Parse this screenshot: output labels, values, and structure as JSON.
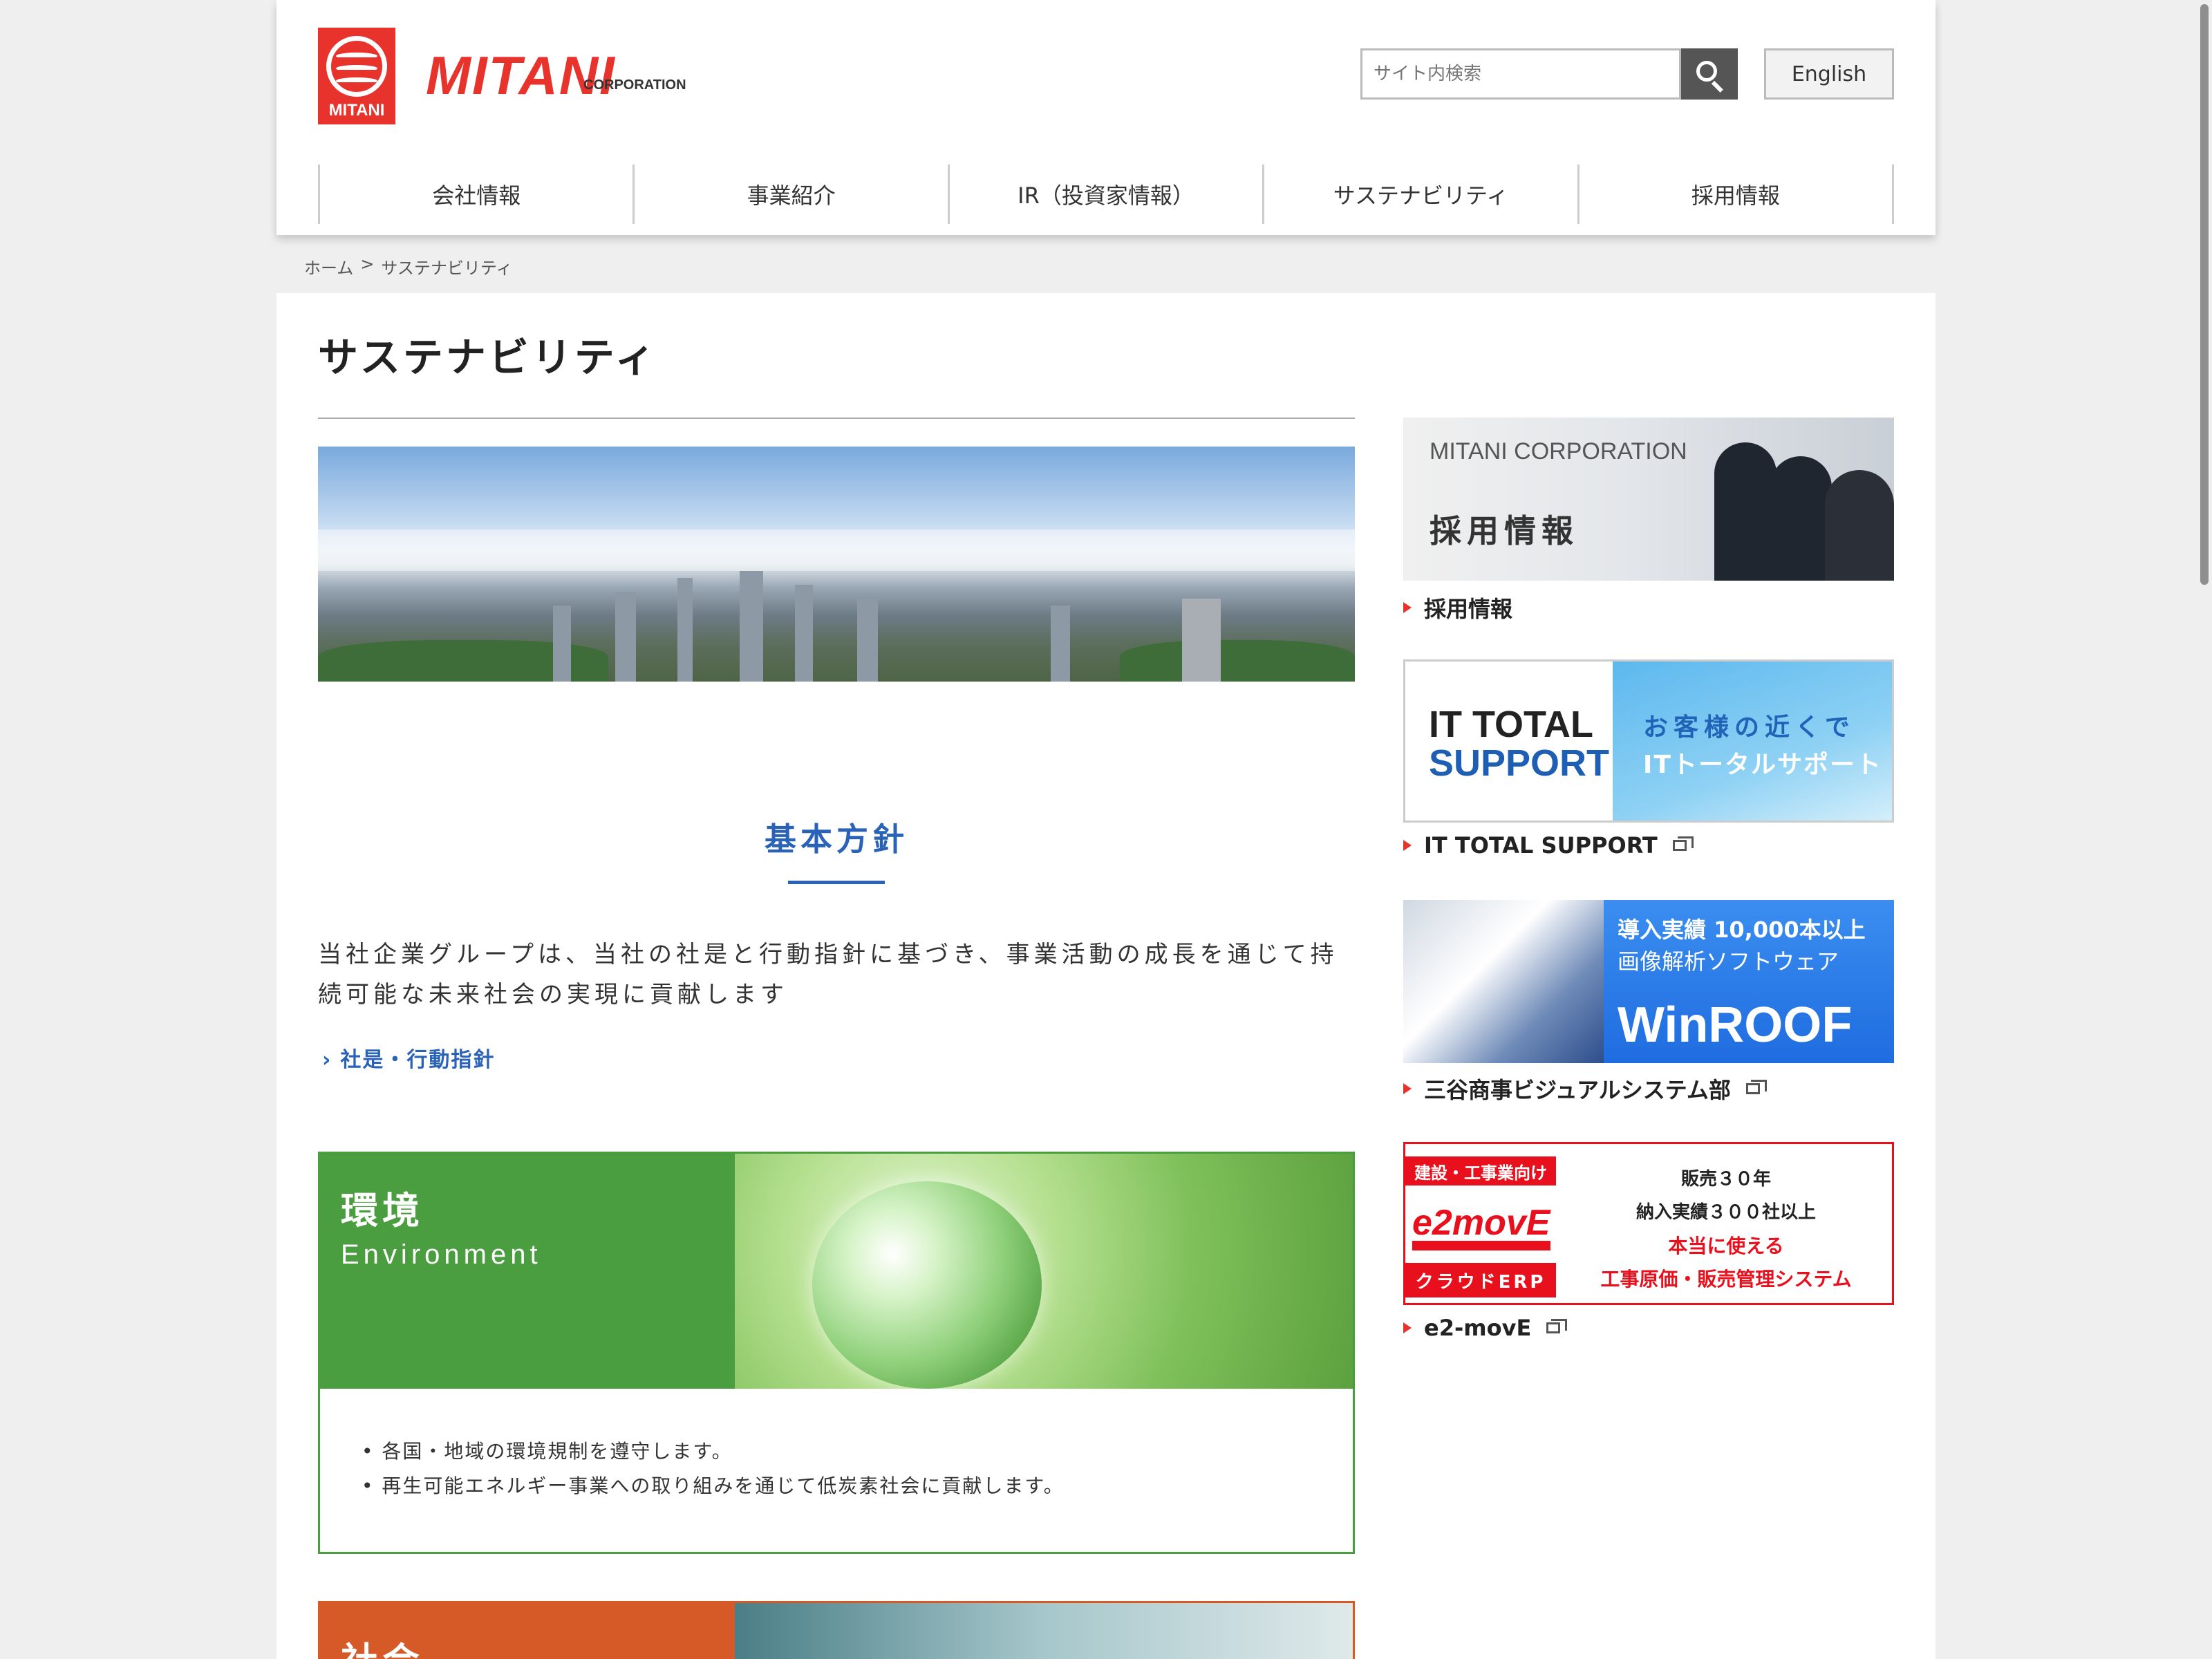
{
  "brand": {
    "logo_mark_text": "MITANI",
    "name": "MITANI",
    "sub": "CORPORATION",
    "color": "#e8322c"
  },
  "header": {
    "search_placeholder": "サイト内検索",
    "search_icon": "search-icon",
    "language_label": "English"
  },
  "nav": {
    "items": [
      "会社情報",
      "事業紹介",
      "IR（投資家情報）",
      "サステナビリティ",
      "採用情報"
    ]
  },
  "breadcrumb": {
    "home": "ホーム",
    "separator": ">",
    "current": "サステナビリティ"
  },
  "page": {
    "title": "サステナビリティ"
  },
  "policy": {
    "heading": "基本方針",
    "text": "当社企業グループは、当社の社是と行動指針に基づき、事業活動の成長を通じて持続可能な未来社会の実現に貢献します",
    "link_label": "社是・行動指針",
    "accent": "#2a62b8"
  },
  "environment": {
    "title_jp": "環境",
    "title_en": "Environment",
    "items": [
      "各国・地域の環境規制を遵守します。",
      "再生可能エネルギー事業への取り組みを通じて低炭素社会に貢献します。"
    ],
    "color": "#4a9e3f"
  },
  "society": {
    "title_jp": "社会",
    "color": "#d65a28"
  },
  "sidebar": {
    "recruit": {
      "banner_top": "MITANI CORPORATION",
      "banner_main": "採用情報",
      "label": "採用情報"
    },
    "it_support": {
      "banner_l1": "IT TOTAL",
      "banner_l2": "SUPPORT",
      "banner_r1": "お客様の近くで",
      "banner_r2": "ITトータルサポート",
      "label": "IT TOTAL SUPPORT"
    },
    "winroof": {
      "banner_t1": "導入実績 10,000本以上",
      "banner_t2": "画像解析ソフトウェア",
      "banner_t3": "WinROOF",
      "label": "三谷商事ビジュアルシステム部"
    },
    "e2move": {
      "tag1": "建設・工事業向け",
      "logo": "e2movE",
      "tag2": "クラウドERP",
      "r1": "販売３０年",
      "r2": "納入実績３００社以上",
      "r3": "本当に使える",
      "r4": "工事原価・販売管理システム",
      "label": "e2-movE"
    }
  }
}
